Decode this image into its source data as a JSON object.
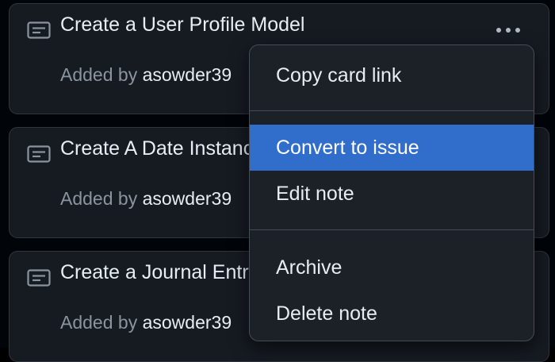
{
  "cards": [
    {
      "title": "Create a User Profile Model",
      "added_by_label": "Added by",
      "author": "asowder39"
    },
    {
      "title": "Create A Date Instance",
      "added_by_label": "Added by",
      "author": "asowder39"
    },
    {
      "title": "Create a Journal Entry",
      "added_by_label": "Added by",
      "author": "asowder39"
    }
  ],
  "card_menu": {
    "copy_link": "Copy card link",
    "convert": "Convert to issue",
    "edit": "Edit note",
    "archive": "Archive",
    "delete": "Delete note",
    "highlighted_item": "Convert to issue"
  },
  "icons": {
    "card_type": "note-icon",
    "card_actions": "kebab-horizontal-icon"
  },
  "colors": {
    "background": "#010409",
    "card": "#161b22",
    "menu": "#1c2128",
    "highlight": "#316dca",
    "muted_text": "#8b949e",
    "text": "#e6edf3"
  }
}
